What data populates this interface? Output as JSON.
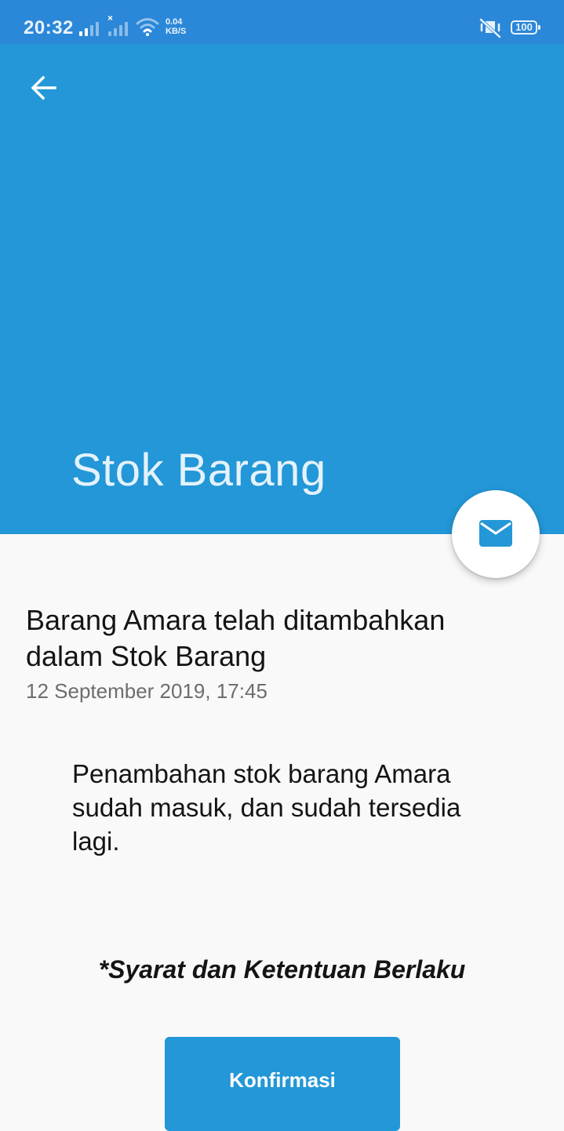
{
  "status_bar": {
    "time": "20:32",
    "net_speed_value": "0.04",
    "net_speed_unit": "KB/S",
    "battery": "100",
    "icons": [
      "signal-icon",
      "signal-no-sim-icon",
      "wifi-icon",
      "mute-icon",
      "battery-icon"
    ]
  },
  "header": {
    "back_icon": "arrow-left-icon",
    "title": "Stok Barang",
    "background": "#2397d7"
  },
  "fab": {
    "icon": "mail-icon"
  },
  "message": {
    "title": "Barang Amara telah ditambahkan dalam Stok Barang",
    "date": "12 September 2019, 17:45",
    "body": "Penambahan stok barang Amara sudah masuk, dan sudah tersedia lagi."
  },
  "terms": "*Syarat dan Ketentuan Berlaku",
  "actions": {
    "confirm_label": "Konfirmasi"
  },
  "colors": {
    "accent": "#2397d7",
    "status_bar": "#2b87d8",
    "background": "#f9f9f9"
  }
}
